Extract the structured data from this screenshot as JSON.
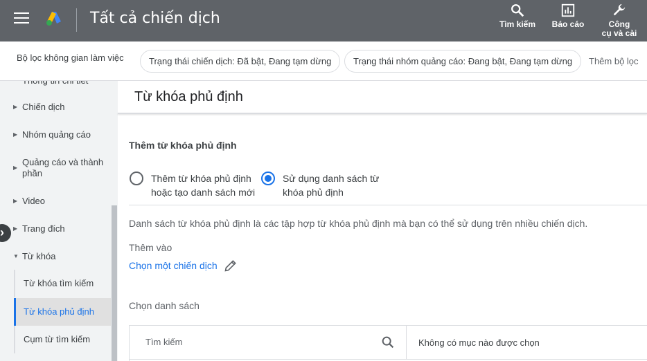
{
  "header": {
    "title": "Tất cả chiến dịch",
    "tools": [
      {
        "label": "Tìm kiếm",
        "icon": "search-icon"
      },
      {
        "label": "Báo cáo",
        "icon": "report-icon"
      },
      {
        "label_line1": "Công",
        "label_line2": "cụ và cài",
        "icon": "wrench-icon"
      }
    ]
  },
  "filters": {
    "label": "Bộ lọc không gian làm việc",
    "chips": [
      "Trạng thái chiến dịch: Đã bật, Đang tạm dừng",
      "Trạng thái nhóm quảng cáo: Đang bật, Đang tạm dừng"
    ],
    "add_filter": "Thêm bộ lọc"
  },
  "sidebar": {
    "partial_top": "Thông tin chi tiết",
    "items": [
      {
        "label": "Chiến dịch"
      },
      {
        "label": "Nhóm quảng cáo"
      },
      {
        "label": "Quảng cáo và thành phần"
      },
      {
        "label": "Video"
      },
      {
        "label": "Trang đích"
      },
      {
        "label": "Từ khóa"
      }
    ],
    "sub_items": [
      {
        "label": "Từ khóa tìm kiếm"
      },
      {
        "label": "Từ khóa phủ định"
      },
      {
        "label": "Cụm từ tìm kiếm"
      }
    ]
  },
  "main": {
    "title": "Từ khóa phủ định",
    "section_title": "Thêm từ khóa phủ định",
    "radio_options": [
      {
        "line1": "Thêm từ khóa phủ định",
        "line2": "hoặc tạo danh sách mới",
        "checked": false
      },
      {
        "line1": "Sử dụng danh sách từ",
        "line2": "khóa phủ định",
        "checked": true
      }
    ],
    "description": "Danh sách từ khóa phủ định là các tập hợp từ khóa phủ định mà bạn có thể sử dụng trên nhiều chiến dịch.",
    "add_to_label": "Thêm vào",
    "choose_campaign": "Chọn một chiến dịch",
    "choose_list_label": "Chọn danh sách",
    "search_placeholder": "Tìm kiếm",
    "no_selection": "Không có mục nào được chọn"
  },
  "colors": {
    "header_bg": "#5f6368",
    "accent": "#1a73e8",
    "sidebar_bg": "#f1f3f4"
  }
}
